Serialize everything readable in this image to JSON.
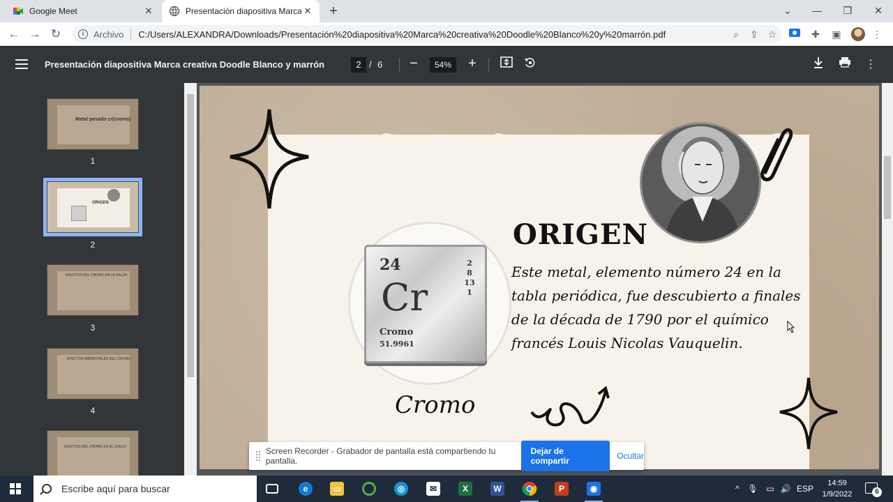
{
  "browser": {
    "tabs": [
      {
        "label": "Google Meet",
        "icon": "google-meet-icon"
      },
      {
        "label": "Presentación diapositiva Marca c",
        "icon": "globe-icon"
      }
    ],
    "new_tab": "+",
    "window_controls": {
      "minimize": "—",
      "maximize": "❐",
      "close": "✕",
      "dropdown": "⌄"
    },
    "nav": {
      "back": "←",
      "forward": "→",
      "reload": "↻"
    },
    "address": {
      "scheme": "Archivo",
      "url": "C:/Users/ALEXANDRA/Downloads/Presentación%20diapositiva%20Marca%20creativa%20Doodle%20Blanco%20y%20marrón.pdf"
    }
  },
  "pdf_toolbar": {
    "title": "Presentación diapositiva Marca creativa Doodle Blanco y marrón",
    "current_page": "2",
    "page_separator": "/",
    "total_pages": "6",
    "zoom_out": "−",
    "zoom_level": "54%",
    "zoom_in": "+"
  },
  "sidebar": {
    "thumbnails": [
      {
        "number": "1",
        "label": "Metal pesado cr(cromo)"
      },
      {
        "number": "2",
        "label": "ORIGEN"
      },
      {
        "number": "3",
        "label": "EFECTOS DEL CROMO EN LA SALUD"
      },
      {
        "number": "4",
        "label": "EFECTOS AMBIENTALES DEL CROMO"
      },
      {
        "number": "",
        "label": "EFECTOS DEL CROMO EN EL SUELO"
      }
    ]
  },
  "slide": {
    "title": "ORIGEN",
    "body": "Este metal, elemento número 24 en la tabla periódica, fue descubierto a finales de la década de 1790 por el químico francés Louis Nicolas Vauquelin.",
    "caption": "Cromo",
    "element": {
      "atomic_number": "24",
      "symbol": "Cr",
      "name": "Cromo",
      "mass": "51.9961",
      "shells": [
        "2",
        "8",
        "13",
        "1"
      ]
    }
  },
  "share_banner": {
    "message": "Screen Recorder - Grabador de pantalla está compartiendo tu pantalla.",
    "stop_label": "Dejar de compartir",
    "hide_label": "Ocultar"
  },
  "taskbar": {
    "search_placeholder": "Escribe aquí para buscar",
    "language": "ESP",
    "time": "14:59",
    "date": "1/9/2022",
    "notifications": "6",
    "apps": [
      "task-view",
      "edge",
      "file-explorer",
      "qlik",
      "maps",
      "mail",
      "excel",
      "word",
      "chrome",
      "powerpoint",
      "screen-recorder"
    ]
  },
  "colors": {
    "pdf_toolbar": "#323639",
    "accent_blue": "#1a73e8",
    "taskbar": "#1f2b3a"
  }
}
